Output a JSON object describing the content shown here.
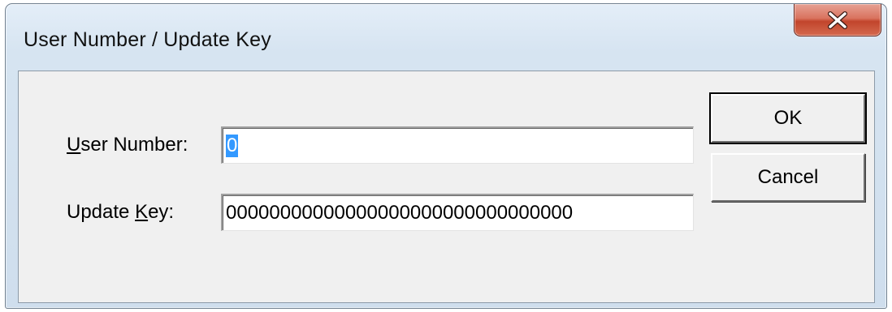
{
  "window": {
    "title": "User Number / Update Key",
    "close_icon": "close-icon"
  },
  "form": {
    "user_number": {
      "label_hotkey": "U",
      "label_rest": "ser Number:",
      "value": "0"
    },
    "update_key": {
      "label_prefix": "Update ",
      "label_hotkey": "K",
      "label_rest": "ey:",
      "value": "00000000000000000000000000000000"
    }
  },
  "buttons": {
    "ok_label": "OK",
    "cancel_label": "Cancel"
  },
  "colors": {
    "close_button": "#c2452c",
    "selection": "#3399ff",
    "dialog_face": "#f0f0f0"
  }
}
